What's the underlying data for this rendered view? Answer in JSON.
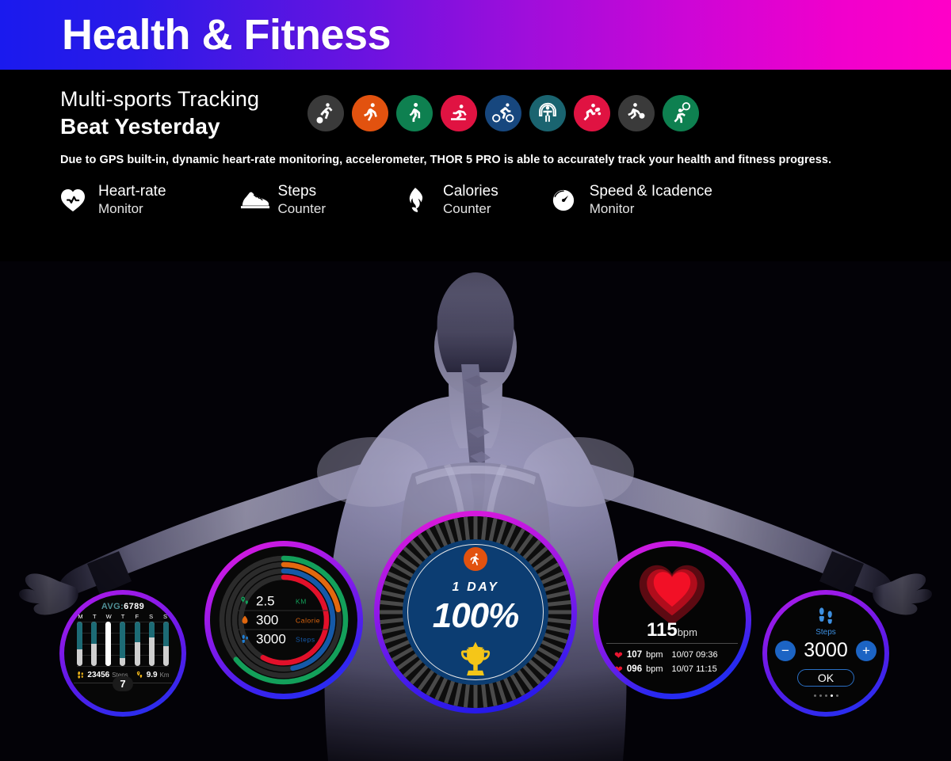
{
  "header": {
    "title": "Health & Fitness"
  },
  "intro": {
    "subtitle": "Multi-sports Tracking",
    "title": "Beat Yesterday",
    "description": "Due to GPS built-in, dynamic heart-rate monitoring, accelerometer, THOR 5 PRO is able to accurately track your health and fitness progress."
  },
  "sports": [
    {
      "name": "basketball-icon",
      "color": "#3a3a3a"
    },
    {
      "name": "running-icon",
      "color": "#e2520f"
    },
    {
      "name": "walking-icon",
      "color": "#0e8050"
    },
    {
      "name": "treadmill-icon",
      "color": "#e01342"
    },
    {
      "name": "cycling-icon",
      "color": "#17477e"
    },
    {
      "name": "jump-rope-icon",
      "color": "#1a6470"
    },
    {
      "name": "table-tennis-icon",
      "color": "#e01342"
    },
    {
      "name": "football-icon",
      "color": "#3a3a3a"
    },
    {
      "name": "badminton-icon",
      "color": "#0e8050"
    }
  ],
  "features": [
    {
      "icon": "heart-icon",
      "line1": "Heart-rate",
      "line2": "Monitor"
    },
    {
      "icon": "shoe-icon",
      "line1": "Steps",
      "line2": "Counter"
    },
    {
      "icon": "flame-icon",
      "line1": "Calories",
      "line2": "Counter"
    },
    {
      "icon": "speedometer-icon",
      "line1": "Speed & Icadence",
      "line2": "Monitor"
    }
  ],
  "watch_weekly_steps": {
    "avg_label": "AVG:",
    "avg_value": "6789",
    "days": [
      "M",
      "T",
      "W",
      "T",
      "F",
      "S",
      "S"
    ],
    "bar_values": [
      62,
      50,
      100,
      82,
      46,
      35,
      56
    ],
    "highlight_index": 2,
    "steps_value": "23456",
    "steps_unit": "Steps",
    "distance_value": "9.9",
    "distance_unit": "Km",
    "badge": "7"
  },
  "watch_rings": {
    "rows": [
      {
        "icon": "route-icon",
        "value": "2.5",
        "unit": "KM",
        "color": "#13a05a",
        "percent": 64
      },
      {
        "icon": "flame-icon",
        "value": "300",
        "unit": "Calorie",
        "color": "#e2680f",
        "percent": 22
      },
      {
        "icon": "steps-icon",
        "value": "3000",
        "unit": "Steps",
        "color": "#1559a8",
        "percent": 47
      },
      {
        "icon": "progress-icon",
        "value": "",
        "unit": "",
        "color": "#e2102a",
        "percent": 58
      }
    ]
  },
  "watch_goal": {
    "badge_icon": "walking-icon",
    "period": "1 DAY",
    "percent": "100%",
    "trophy_icon": "trophy-icon"
  },
  "watch_heart": {
    "current_value": "115",
    "current_unit": "bpm",
    "history": [
      {
        "value": "107",
        "unit": "bpm",
        "date": "10/07 09:36"
      },
      {
        "value": "096",
        "unit": "bpm",
        "date": "10/07 11:15"
      }
    ]
  },
  "watch_steps_goal": {
    "icon": "footprints-icon",
    "label": "Steps",
    "minus": "−",
    "plus": "+",
    "value": "3000",
    "ok_label": "OK",
    "dots": 5,
    "active_dot": 3
  }
}
